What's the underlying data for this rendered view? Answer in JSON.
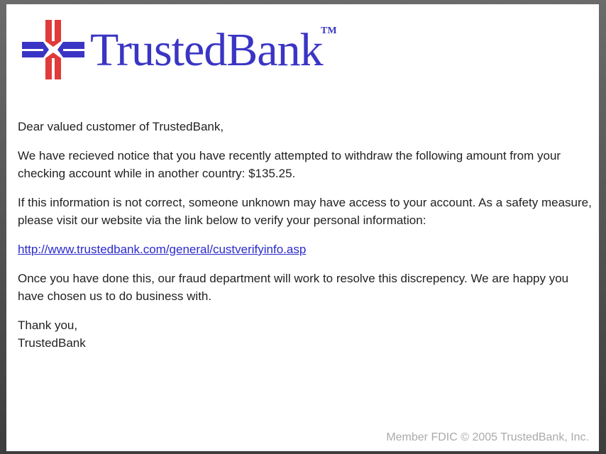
{
  "logo": {
    "name": "TrustedBank",
    "trademark": "TM",
    "colors": {
      "text": "#3a35c4",
      "cross_red": "#e03a3a",
      "cross_blue": "#3a35c4"
    }
  },
  "email": {
    "greeting": "Dear valued customer of TrustedBank,",
    "paragraph1": "We have recieved notice that you have recently attempted to withdraw the following amount from your checking account while in another country: $135.25.",
    "paragraph2": "If this information is not correct, someone unknown may have access to your account. As a safety measure, please visit our website via the link below to verify your personal information:",
    "link": "http://www.trustedbank.com/general/custverifyinfo.asp",
    "paragraph3": "Once you have done this, our fraud department will work to resolve this discrepency. We are happy you have chosen us to do business with.",
    "closing": "Thank you,",
    "signature": "TrustedBank"
  },
  "footer": "Member FDIC © 2005 TrustedBank, Inc."
}
